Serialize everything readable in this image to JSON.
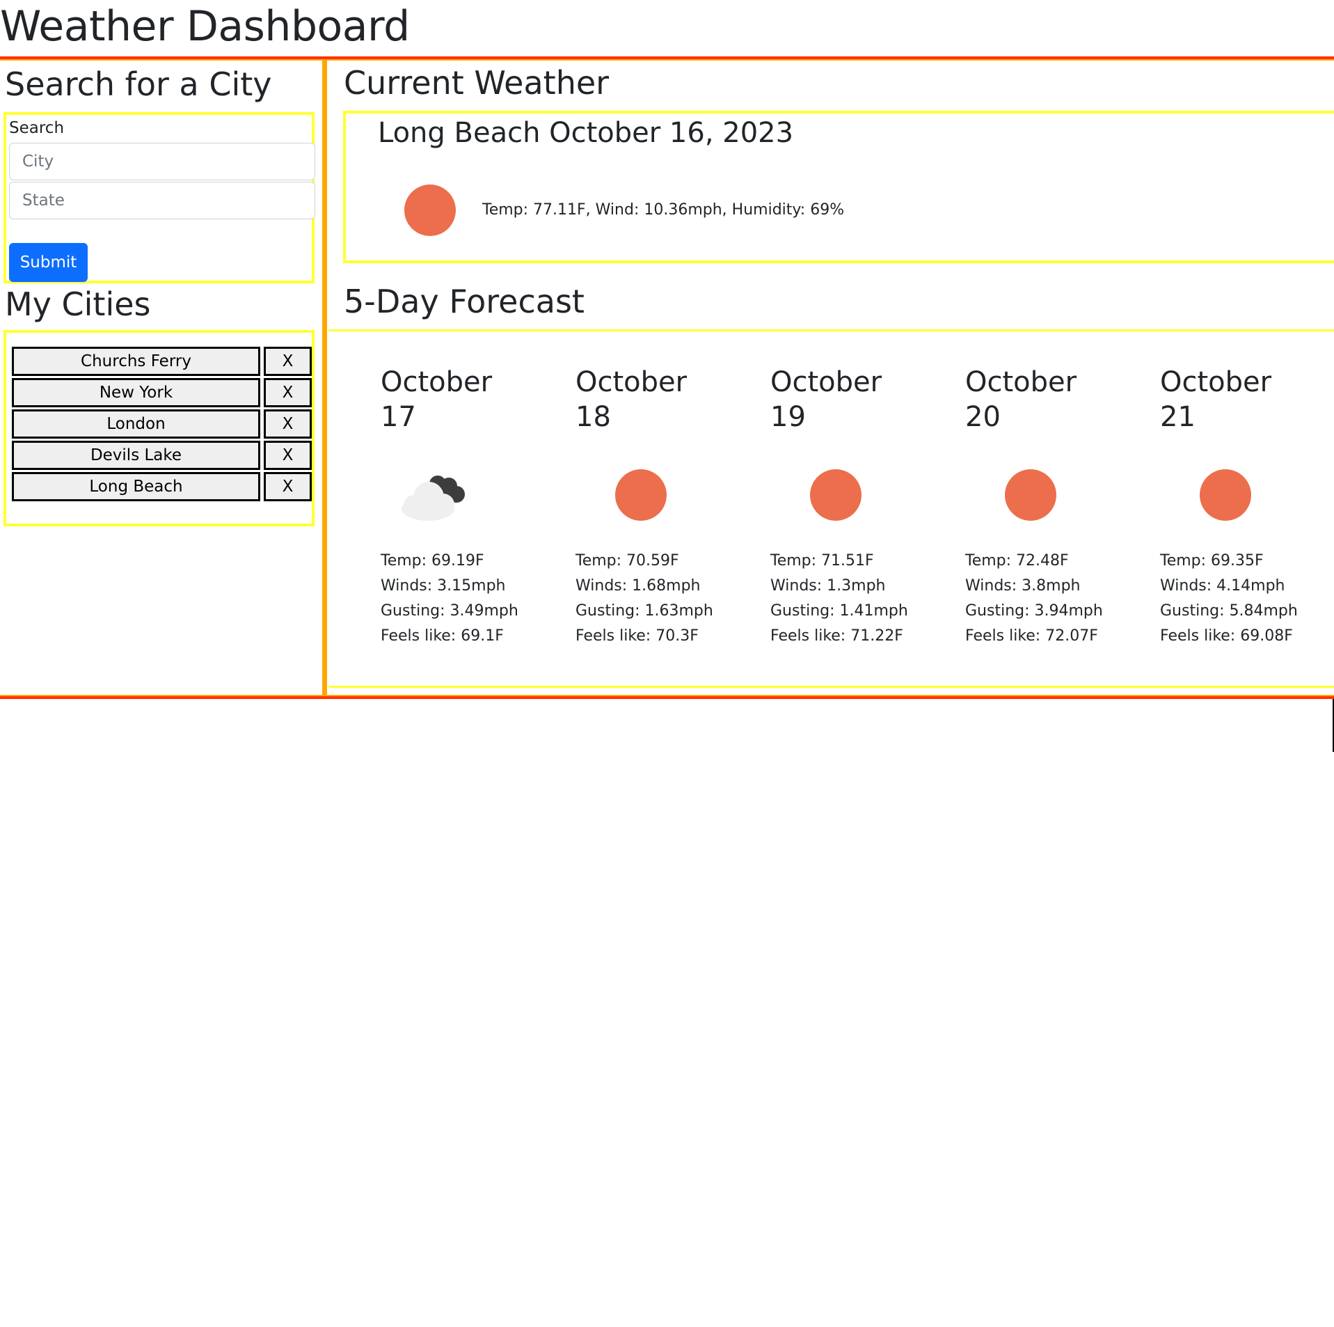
{
  "page": {
    "title": "Weather Dashboard"
  },
  "sidebar": {
    "search_heading": "Search for a City",
    "search_label": "Search",
    "city_placeholder": "City",
    "state_placeholder": "State",
    "submit_label": "Submit",
    "cities_heading": "My Cities",
    "remove_label": "X",
    "cities": [
      {
        "name": "Churchs Ferry"
      },
      {
        "name": "New York"
      },
      {
        "name": "London"
      },
      {
        "name": "Devils Lake"
      },
      {
        "name": "Long Beach"
      }
    ]
  },
  "current": {
    "heading": "Current Weather",
    "title": "Long Beach October 16, 2023",
    "icon": "sun-icon",
    "stats": "Temp: 77.11F, Wind: 10.36mph, Humidity: 69%"
  },
  "forecast": {
    "heading": "5-Day Forecast",
    "days": [
      {
        "date": "October 17",
        "icon": "cloud-icon",
        "temp": "Temp: 69.19F",
        "winds": "Winds: 3.15mph",
        "gusting": "Gusting: 3.49mph",
        "feels": "Feels like: 69.1F"
      },
      {
        "date": "October 18",
        "icon": "sun-icon",
        "temp": "Temp: 70.59F",
        "winds": "Winds: 1.68mph",
        "gusting": "Gusting: 1.63mph",
        "feels": "Feels like: 70.3F"
      },
      {
        "date": "October 19",
        "icon": "sun-icon",
        "temp": "Temp: 71.51F",
        "winds": "Winds: 1.3mph",
        "gusting": "Gusting: 1.41mph",
        "feels": "Feels like: 71.22F"
      },
      {
        "date": "October 20",
        "icon": "sun-icon",
        "temp": "Temp: 72.48F",
        "winds": "Winds: 3.8mph",
        "gusting": "Gusting: 3.94mph",
        "feels": "Feels like: 72.07F"
      },
      {
        "date": "October 21",
        "icon": "sun-icon",
        "temp": "Temp: 69.35F",
        "winds": "Winds: 4.14mph",
        "gusting": "Gusting: 5.84mph",
        "feels": "Feels like: 69.08F"
      }
    ]
  },
  "colors": {
    "outer_border": "#ff3300",
    "column_border": "#ffa500",
    "box_border": "#ffff33",
    "sun": "#ec6e4c",
    "submit": "#0d6efd"
  }
}
